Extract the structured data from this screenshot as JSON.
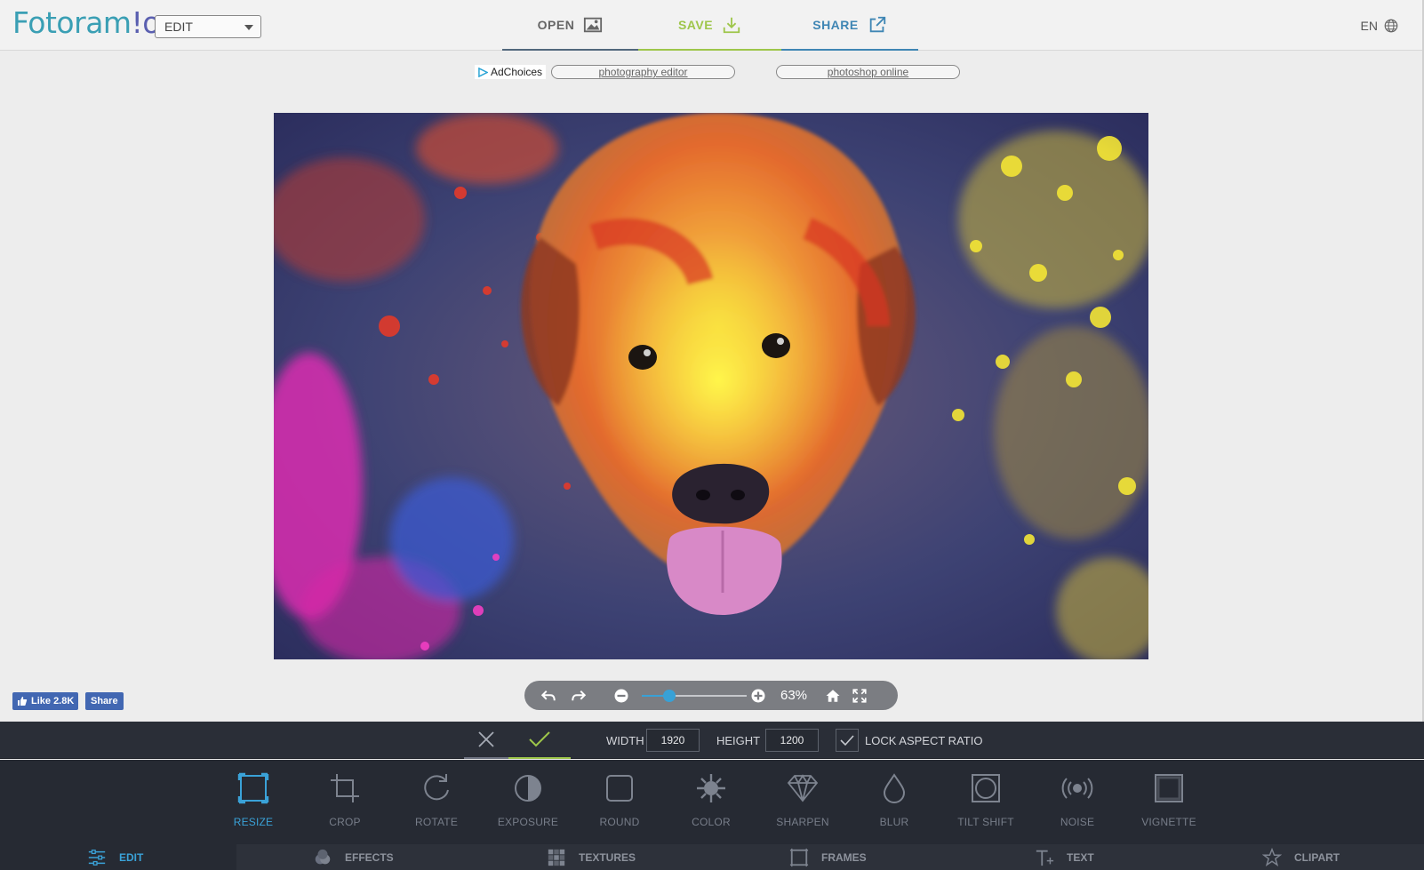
{
  "app": {
    "logo_main": "Fotoram",
    "logo_tail": "!o",
    "mode_select_value": "EDIT"
  },
  "header": {
    "nav": [
      {
        "label": "OPEN",
        "icon": "image-icon",
        "color": "#666666"
      },
      {
        "label": "SAVE",
        "icon": "download-icon",
        "color": "#9ec64a"
      },
      {
        "label": "SHARE",
        "icon": "share-icon",
        "color": "#3f86b4"
      }
    ],
    "language": "EN"
  },
  "ads": {
    "adchoices_label": "AdChoices",
    "links": [
      "photography editor",
      "photoshop online"
    ]
  },
  "social": {
    "like_label": "Like 2.8K",
    "share_label": "Share"
  },
  "zoom": {
    "percent_label": "63%",
    "slider_fraction": 0.26
  },
  "options": {
    "width_label": "WIDTH",
    "width_value": "1920",
    "height_label": "HEIGHT",
    "height_value": "1200",
    "lock_label": "LOCK ASPECT RATIO",
    "lock_checked": true
  },
  "tools": [
    {
      "label": "RESIZE",
      "icon": "resize-icon",
      "active": true
    },
    {
      "label": "CROP",
      "icon": "crop-icon",
      "active": false
    },
    {
      "label": "ROTATE",
      "icon": "rotate-icon",
      "active": false
    },
    {
      "label": "EXPOSURE",
      "icon": "exposure-icon",
      "active": false
    },
    {
      "label": "ROUND",
      "icon": "round-corners-icon",
      "active": false
    },
    {
      "label": "COLOR",
      "icon": "color-splash-icon",
      "active": false
    },
    {
      "label": "SHARPEN",
      "icon": "diamond-icon",
      "active": false
    },
    {
      "label": "BLUR",
      "icon": "drop-icon",
      "active": false
    },
    {
      "label": "TILT SHIFT",
      "icon": "tilt-shift-icon",
      "active": false
    },
    {
      "label": "NOISE",
      "icon": "noise-icon",
      "active": false
    },
    {
      "label": "VIGNETTE",
      "icon": "vignette-icon",
      "active": false
    }
  ],
  "tabs": [
    {
      "label": "EDIT",
      "icon": "sliders-icon",
      "active": true
    },
    {
      "label": "EFFECTS",
      "icon": "effects-icon",
      "active": false
    },
    {
      "label": "TEXTURES",
      "icon": "textures-icon",
      "active": false
    },
    {
      "label": "FRAMES",
      "icon": "frame-icon",
      "active": false
    },
    {
      "label": "TEXT",
      "icon": "text-icon",
      "active": false
    },
    {
      "label": "CLIPART",
      "icon": "star-icon",
      "active": false
    }
  ],
  "colors": {
    "accent_blue": "#3aa2d8",
    "save_green": "#9ec64a",
    "panel_dark": "#262a33"
  }
}
